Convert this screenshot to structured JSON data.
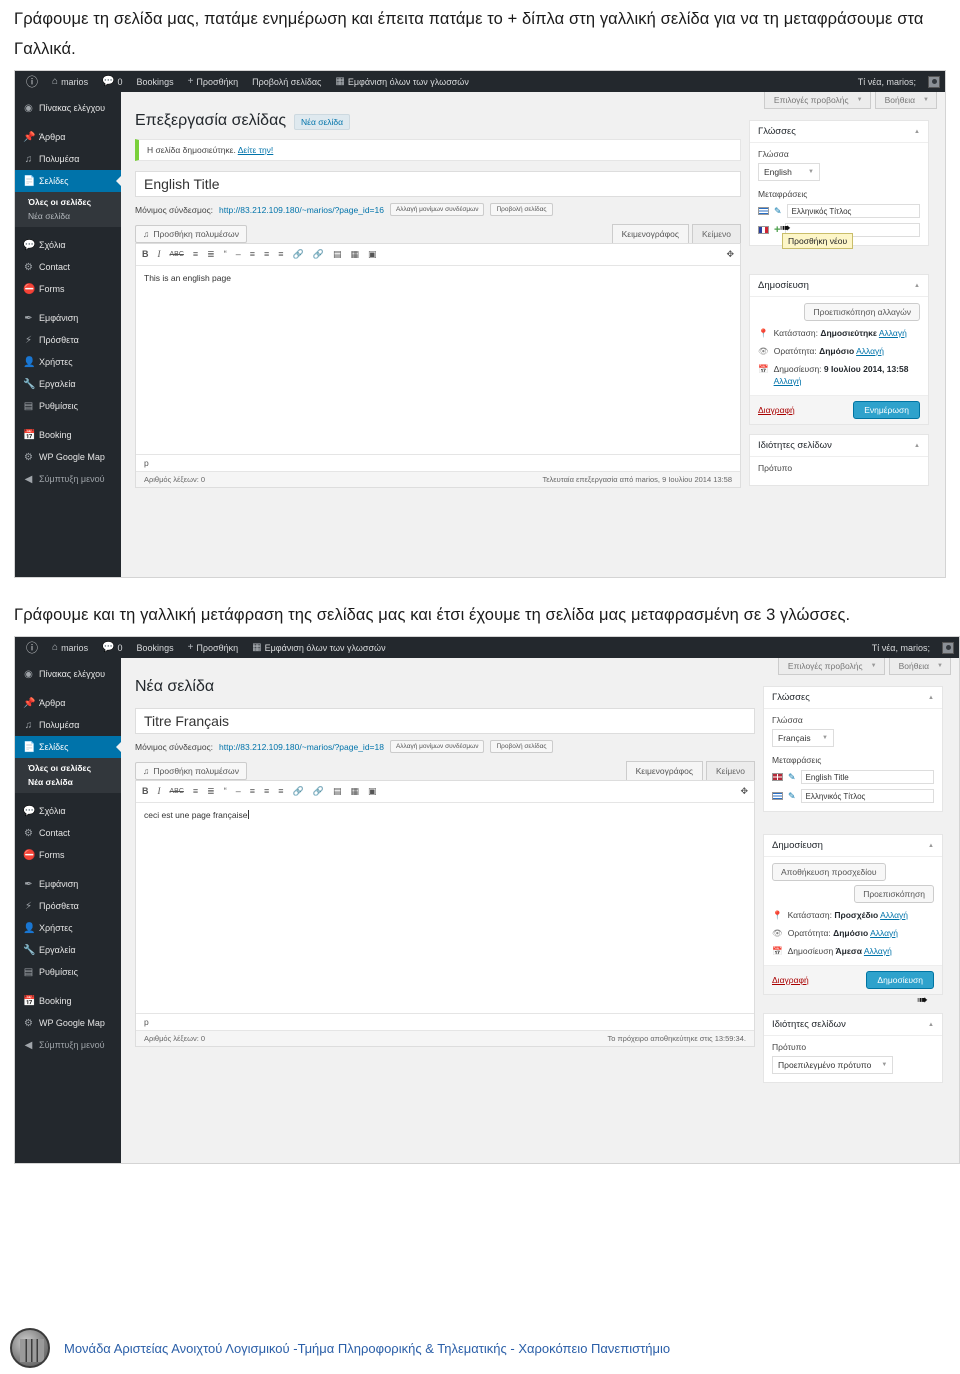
{
  "document": {
    "intro_paragraph": "Γράφουμε τη σελίδα μας, πατάμε ενημέρωση και έπειτα πατάμε το + δίπλα στη γαλλική σελίδα για να τη μεταφράσουμε στα Γαλλικά.",
    "middle_paragraph": "Γράφουμε και τη γαλλική μετάφραση της σελίδας μας και έτσι έχουμε τη σελίδα μας μεταφρασμένη σε 3 γλώσσες.",
    "footer_text": "Μονάδα Αριστείας Ανοιχτού Λογισμικού  -Τμήμα Πληροφορικής & Τηλεματικής - Χαροκόπειο Πανεπιστήμιο",
    "footer_logo": "university-seal-logo"
  },
  "screenshot1": {
    "adminbar": {
      "wp_logo": "wordpress-logo-icon",
      "site_icon": "home-icon",
      "site_name": "marios",
      "comments_icon": "comment-bubble-icon",
      "comments_count": "0",
      "bookings": "Bookings",
      "new_icon": "plus-icon",
      "new_label": "Προσθήκη",
      "view_page": "Προβολή σελίδας",
      "languages_icon": "languages-flags-icon",
      "languages_label": "Εμφάνιση όλων των γλωσσών",
      "howdy": "Τί νέα, marios;",
      "avatar": "user-avatar"
    },
    "menu": {
      "dashboard": "Πίνακας ελέγχου",
      "posts": "Άρθρα",
      "media": "Πολυμέσα",
      "pages": "Σελίδες",
      "sub_all_pages": "Όλες οι σελίδες",
      "sub_new_page": "Νέα σελίδα",
      "comments": "Σχόλια",
      "contact": "Contact",
      "forms": "Forms",
      "appearance": "Εμφάνιση",
      "plugins": "Πρόσθετα",
      "users": "Χρήστες",
      "tools": "Εργαλεία",
      "settings": "Ρυθμίσεις",
      "booking": "Booking",
      "wp_google_map": "WP Google Map",
      "collapse": "Σύμπτυξη μενού"
    },
    "screen_meta": {
      "screen_options": "Επιλογές προβολής",
      "help": "Βοήθεια"
    },
    "main": {
      "page_title": "Επεξεργασία σελίδας",
      "add_new_label": "Νέα σελίδα",
      "notice_text": "Η σελίδα δημοσιεύτηκε.",
      "notice_link": "Δείτε την!",
      "title_value": "English Title",
      "permalink_label": "Μόνιμος σύνδεσμος:",
      "permalink_url": "http://83.212.109.180/~marios/?page_id=16",
      "permalink_edit_btn": "Αλλαγή μονίμων συνδέσμων",
      "permalink_view_btn": "Προβολή σελίδας",
      "add_media_btn": "Προσθήκη πολυμέσων",
      "add_media_icon": "media-icon",
      "tab_visual": "Κειμενογράφος",
      "tab_text": "Κείμενο",
      "editor_content": "This is an english page",
      "editor_path": "p",
      "word_count": "Αριθμός λέξεων: 0",
      "last_edited": "Τελευταία επεξεργασία από marios, 9 Ιουλίου 2014 13:58",
      "toolbar_icons": [
        "bold-icon",
        "italic-icon",
        "strikethrough-icon",
        "unordered-list-icon",
        "ordered-list-icon",
        "blockquote-icon",
        "horizontal-rule-icon",
        "align-left-icon",
        "align-center-icon",
        "align-right-icon",
        "link-icon",
        "unlink-icon",
        "read-more-icon",
        "spellcheck-icon",
        "toggle-toolbar-icon"
      ],
      "fullscreen_icon": "fullscreen-icon"
    },
    "languages_box": {
      "title": "Γλώσσες",
      "toggle_icon": "chevron-up-icon",
      "language_label": "Γλώσσα",
      "language_value": "English",
      "translations_label": "Μεταφράσεις",
      "rows": [
        {
          "flag": "flag-greek",
          "action_icon": "pencil-icon",
          "value": "Ελληνικός Τίτλος"
        },
        {
          "flag": "flag-french",
          "action_icon": "plus-icon",
          "value": ""
        }
      ],
      "tooltip": "Προσθήκη νέου",
      "cursor": "mouse-pointer"
    },
    "publish_box": {
      "title": "Δημοσίευση",
      "toggle_icon": "chevron-up-icon",
      "preview_btn": "Προεπισκόπηση αλλαγών",
      "status_icon": "pin-icon",
      "status_label": "Κατάσταση:",
      "status_value": "Δημοσιεύτηκε",
      "status_edit": "Αλλαγή",
      "visibility_icon": "eye-icon",
      "visibility_label": "Ορατότητα:",
      "visibility_value": "Δημόσιο",
      "visibility_edit": "Αλλαγή",
      "date_icon": "calendar-icon",
      "date_label": "Δημοσίευση:",
      "date_value": "9 Ιουλίου 2014, 13:58",
      "date_edit": "Αλλαγή",
      "trash": "Διαγραφή",
      "primary_btn": "Ενημέρωση"
    },
    "attributes_box": {
      "title": "Ιδιότητες σελίδων",
      "toggle_icon": "chevron-up-icon",
      "template_label": "Πρότυπο"
    }
  },
  "screenshot2": {
    "adminbar": {
      "wp_logo": "wordpress-logo-icon",
      "site_icon": "home-icon",
      "site_name": "marios",
      "comments_icon": "comment-bubble-icon",
      "comments_count": "0",
      "bookings": "Bookings",
      "new_icon": "plus-icon",
      "new_label": "Προσθήκη",
      "languages_icon": "languages-flags-icon",
      "languages_label": "Εμφάνιση όλων των γλωσσών",
      "howdy": "Τί νέα, marios;",
      "avatar": "user-avatar"
    },
    "menu": {
      "dashboard": "Πίνακας ελέγχου",
      "posts": "Άρθρα",
      "media": "Πολυμέσα",
      "pages": "Σελίδες",
      "sub_all_pages": "Όλες οι σελίδες",
      "sub_new_page": "Νέα σελίδα",
      "comments": "Σχόλια",
      "contact": "Contact",
      "forms": "Forms",
      "appearance": "Εμφάνιση",
      "plugins": "Πρόσθετα",
      "users": "Χρήστες",
      "tools": "Εργαλεία",
      "settings": "Ρυθμίσεις",
      "booking": "Booking",
      "wp_google_map": "WP Google Map",
      "collapse": "Σύμπτυξη μενού"
    },
    "screen_meta": {
      "screen_options": "Επιλογές προβολής",
      "help": "Βοήθεια"
    },
    "main": {
      "page_title": "Νέα σελίδα",
      "title_value": "Titre Français",
      "permalink_label": "Μόνιμος σύνδεσμος:",
      "permalink_url": "http://83.212.109.180/~marios/?page_id=18",
      "permalink_edit_btn": "Αλλαγή μονίμων συνδέσμων",
      "permalink_view_btn": "Προβολή σελίδας",
      "add_media_btn": "Προσθήκη πολυμέσων",
      "add_media_icon": "media-icon",
      "tab_visual": "Κειμενογράφος",
      "tab_text": "Κείμενο",
      "editor_content": "ceci est une page française",
      "editor_path": "p",
      "word_count": "Αριθμός λέξεων: 0",
      "autosave_text": "Το πρόχειρο αποθηκεύτηκε στις 13:59:34.",
      "fullscreen_icon": "fullscreen-icon"
    },
    "languages_box": {
      "title": "Γλώσσες",
      "toggle_icon": "chevron-up-icon",
      "language_label": "Γλώσσα",
      "language_value": "Français",
      "translations_label": "Μεταφράσεις",
      "rows": [
        {
          "flag": "flag-english",
          "action_icon": "pencil-icon",
          "value": "English Title"
        },
        {
          "flag": "flag-greek",
          "action_icon": "pencil-icon",
          "value": "Ελληνικός Τίτλος"
        }
      ]
    },
    "publish_box": {
      "title": "Δημοσίευση",
      "toggle_icon": "chevron-up-icon",
      "save_draft_btn": "Αποθήκευση προσχεδίου",
      "preview_btn": "Προεπισκόπηση",
      "status_icon": "pin-icon",
      "status_label": "Κατάσταση:",
      "status_value": "Προσχέδιο",
      "status_edit": "Αλλαγή",
      "visibility_icon": "eye-icon",
      "visibility_label": "Ορατότητα:",
      "visibility_value": "Δημόσιο",
      "visibility_edit": "Αλλαγή",
      "date_icon": "calendar-icon",
      "date_label": "Δημοσίευση",
      "date_value": "Άμεσα",
      "date_edit": "Αλλαγή",
      "trash": "Διαγραφή",
      "primary_btn": "Δημοσίευση",
      "cursor": "mouse-pointer"
    },
    "attributes_box": {
      "title": "Ιδιότητες σελίδων",
      "toggle_icon": "chevron-up-icon",
      "template_label": "Πρότυπο",
      "template_value": "Προεπιλεγμένο πρότυπο"
    }
  },
  "colors": {
    "admin_dark": "#23282d",
    "admin_submenu": "#32373c",
    "accent_blue": "#0073aa",
    "button_blue": "#2ea2cc",
    "notice_green": "#7ad03a",
    "trash_red": "#a00",
    "footer_blue": "#2b5fa8",
    "tooltip_yellow": "#fdf6c8"
  }
}
